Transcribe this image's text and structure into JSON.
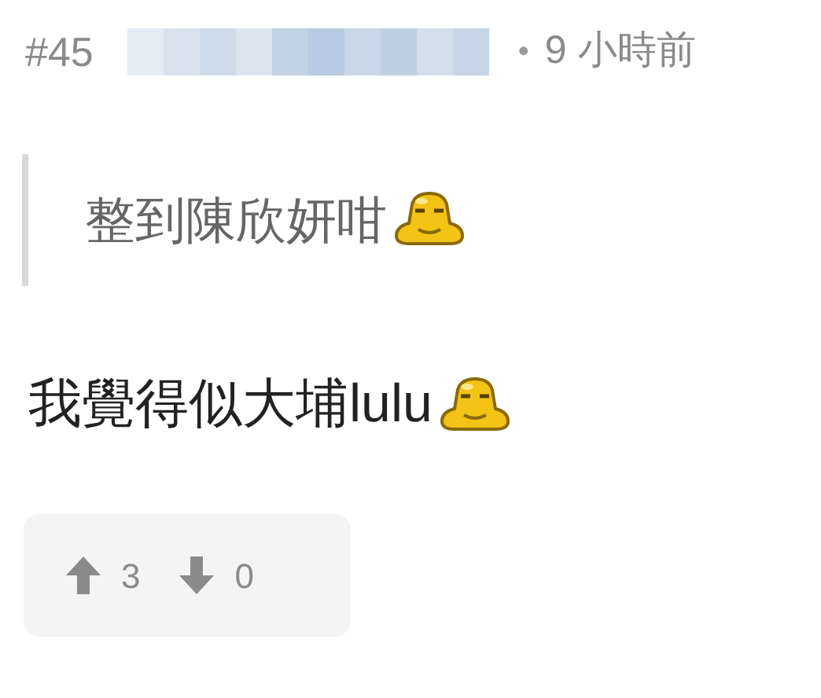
{
  "post": {
    "number": "#45",
    "separator": "•",
    "time": "9 小時前"
  },
  "quote": [
    {
      "kind": "text",
      "text": "整到陳欣妍咁"
    },
    {
      "kind": "emoji"
    }
  ],
  "body": [
    {
      "kind": "text",
      "text": "我覺得似大埔lulu"
    },
    {
      "kind": "emoji"
    }
  ],
  "votes": {
    "up": "3",
    "down": "0"
  }
}
